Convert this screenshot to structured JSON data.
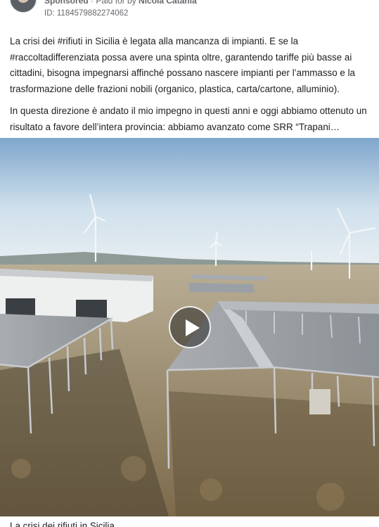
{
  "ad": {
    "sponsored_label": "Sponsored",
    "paid_for_prefix": " · Paid for by ",
    "advertiser": "Nicola Catania",
    "id_text": "ID: 1184579882274062",
    "more_icon": "more-icon"
  },
  "post": {
    "paragraph1": "La crisi dei #rifiuti in Sicilia è legata alla mancanza di impianti. E se la #raccoltadifferenziata possa avere una spinta oltre, garantendo tariffe più basse ai cittadini, bisogna impegnarsi affinché possano nascere impianti per l’ammasso e la trasformazione delle frazioni nobili (organico, plastica, carta/cartone, alluminio).",
    "paragraph2": "In questa direzione è andato il mio impegno in questi anni e oggi abbiamo ottenuto un risultato a favore dell’intera provincia: abbiamo avanzato come SRR “Trapani…"
  },
  "media": {
    "type": "video",
    "play_icon": "play-icon"
  },
  "caption": "La crisi dei rifiuti in Sicilia"
}
